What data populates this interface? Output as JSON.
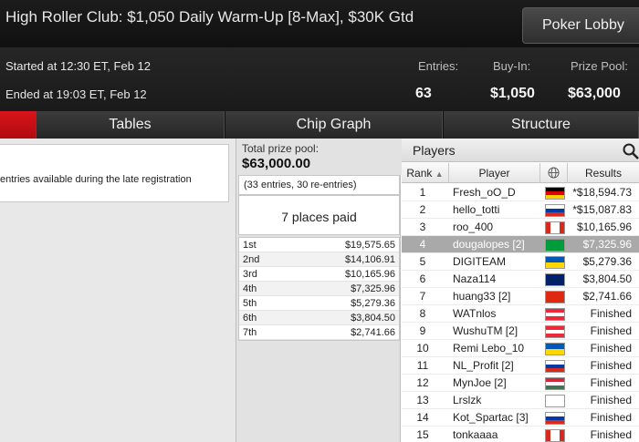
{
  "header": {
    "title": "High Roller Club: $1,050 Daily Warm-Up [8-Max], $30K Gtd",
    "lobby_button": "Poker Lobby"
  },
  "info": {
    "started": "Started at 12:30 ET, Feb 12",
    "ended": "Ended at 19:03 ET, Feb 12",
    "entries_label": "Entries:",
    "entries_value": "63",
    "buyin_label": "Buy-In:",
    "buyin_value": "$1,050",
    "prizepool_label": "Prize Pool:",
    "prizepool_value": "$63,000"
  },
  "tabs": [
    {
      "label": ""
    },
    {
      "label": "Tables"
    },
    {
      "label": "Chip Graph"
    },
    {
      "label": "Structure"
    }
  ],
  "left_note": "entries available during the late registration",
  "prize_pool": {
    "label": "Total prize pool:",
    "amount": "$63,000.00",
    "entries_note": "(33 entries, 30 re-entries)",
    "places_paid": "7 places paid",
    "payouts": [
      {
        "place": "1st",
        "amount": "$19,575.65"
      },
      {
        "place": "2nd",
        "amount": "$14,106.91"
      },
      {
        "place": "3rd",
        "amount": "$10,165.96"
      },
      {
        "place": "4th",
        "amount": "$7,325.96"
      },
      {
        "place": "5th",
        "amount": "$5,279.36"
      },
      {
        "place": "6th",
        "amount": "$3,804.50"
      },
      {
        "place": "7th",
        "amount": "$2,741.66"
      }
    ]
  },
  "players": {
    "title": "Players",
    "columns": {
      "rank": "Rank",
      "player": "Player",
      "results": "Results"
    },
    "rows": [
      {
        "rank": "1",
        "name": "Fresh_oO_D",
        "flag": "de",
        "result": "*$18,594.73"
      },
      {
        "rank": "2",
        "name": "hello_totti",
        "flag": "ru",
        "result": "*$15,087.83"
      },
      {
        "rank": "3",
        "name": "roo_400",
        "flag": "ca",
        "result": "$10,165.96"
      },
      {
        "rank": "4",
        "name": "dougalopes [2]",
        "flag": "br",
        "result": "$7,325.96",
        "selected": true
      },
      {
        "rank": "5",
        "name": "DIGITEAM",
        "flag": "ua",
        "result": "$5,279.36"
      },
      {
        "rank": "6",
        "name": "Naza114",
        "flag": "gb",
        "result": "$3,804.50"
      },
      {
        "rank": "7",
        "name": "huang33 [2]",
        "flag": "cn",
        "result": "$2,741.66"
      },
      {
        "rank": "8",
        "name": "WATnlos",
        "flag": "at",
        "result": "Finished"
      },
      {
        "rank": "9",
        "name": "WushuTM [2]",
        "flag": "at",
        "result": "Finished"
      },
      {
        "rank": "10",
        "name": "Remi Lebo_10",
        "flag": "ua",
        "result": "Finished"
      },
      {
        "rank": "11",
        "name": "NL_Profit [2]",
        "flag": "ru",
        "result": "Finished"
      },
      {
        "rank": "12",
        "name": "MynJoe [2]",
        "flag": "hu",
        "result": "Finished"
      },
      {
        "rank": "13",
        "name": "Lrslzk",
        "flag": "fi",
        "result": "Finished"
      },
      {
        "rank": "14",
        "name": "Kot_Spartac [3]",
        "flag": "ru",
        "result": "Finished"
      },
      {
        "rank": "15",
        "name": "tonkaaaa",
        "flag": "ca",
        "result": "Finished"
      }
    ]
  }
}
